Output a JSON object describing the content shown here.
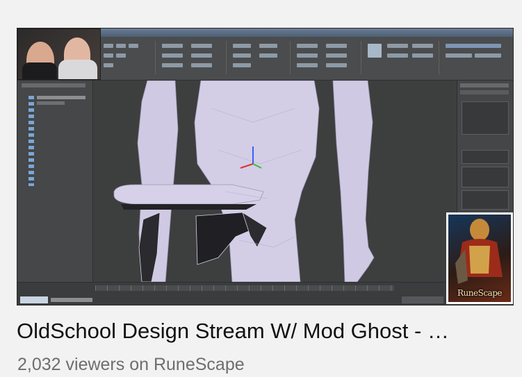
{
  "stream": {
    "title": "OldSchool Design Stream W/ Mod Ghost - …",
    "viewer_count": "2,032",
    "viewers_suffix": "viewers on",
    "game_name": "RuneScape"
  },
  "game_logo": {
    "text": "RuneScape"
  },
  "colors": {
    "background": "#f2f2f2",
    "title": "#111111",
    "meta": "#6e6e6e",
    "viewport": "#3d3f3f",
    "model": "#cfc9e3"
  },
  "icons": {
    "thumbnail": "stream-thumbnail",
    "game_box_art": "runescape-box-art"
  }
}
